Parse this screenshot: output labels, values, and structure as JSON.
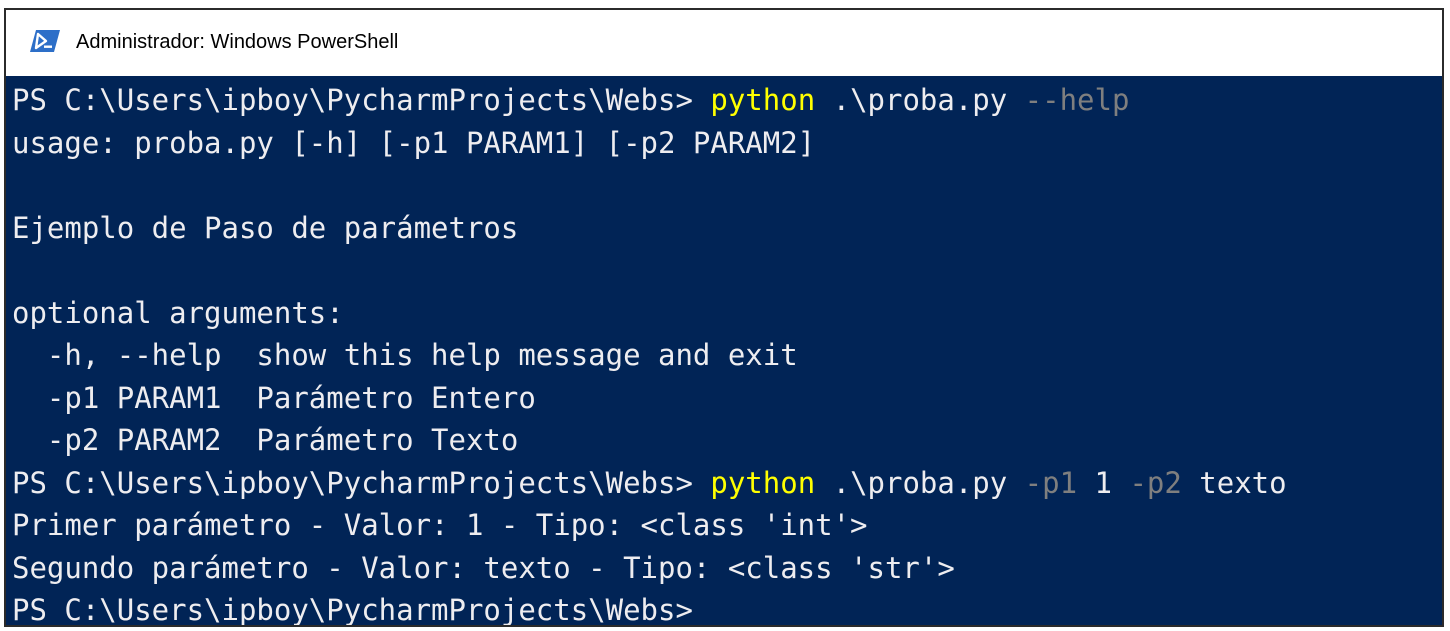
{
  "window": {
    "title": "Administrador: Windows PowerShell",
    "icon": "powershell-icon"
  },
  "colors": {
    "console_background": "#012456",
    "text": "#eeedf0",
    "command": "#ffff00",
    "parameter": "#7f7f7f",
    "titlebar": "#ffffff"
  },
  "console": {
    "lines": [
      {
        "segments": [
          {
            "text": "PS C:\\Users\\ipboy\\PycharmProjects\\Webs> ",
            "style": "text"
          },
          {
            "text": "python",
            "style": "cmd"
          },
          {
            "text": " .\\proba.py ",
            "style": "text"
          },
          {
            "text": "--help",
            "style": "param"
          }
        ]
      },
      {
        "segments": [
          {
            "text": "usage: proba.py [-h] [-p1 PARAM1] [-p2 PARAM2]",
            "style": "text"
          }
        ]
      },
      {
        "segments": [
          {
            "text": "",
            "style": "text"
          }
        ]
      },
      {
        "segments": [
          {
            "text": "Ejemplo de Paso de parámetros",
            "style": "text"
          }
        ]
      },
      {
        "segments": [
          {
            "text": "",
            "style": "text"
          }
        ]
      },
      {
        "segments": [
          {
            "text": "optional arguments:",
            "style": "text"
          }
        ]
      },
      {
        "segments": [
          {
            "text": "  -h, --help  show this help message and exit",
            "style": "text"
          }
        ]
      },
      {
        "segments": [
          {
            "text": "  -p1 PARAM1  Parámetro Entero",
            "style": "text"
          }
        ]
      },
      {
        "segments": [
          {
            "text": "  -p2 PARAM2  Parámetro Texto",
            "style": "text"
          }
        ]
      },
      {
        "segments": [
          {
            "text": "PS C:\\Users\\ipboy\\PycharmProjects\\Webs> ",
            "style": "text"
          },
          {
            "text": "python",
            "style": "cmd"
          },
          {
            "text": " .\\proba.py ",
            "style": "text"
          },
          {
            "text": "-p1",
            "style": "param"
          },
          {
            "text": " 1 ",
            "style": "text"
          },
          {
            "text": "-p2",
            "style": "param"
          },
          {
            "text": " texto",
            "style": "text"
          }
        ]
      },
      {
        "segments": [
          {
            "text": "Primer parámetro - Valor: 1 - Tipo: <class 'int'>",
            "style": "text"
          }
        ]
      },
      {
        "segments": [
          {
            "text": "Segundo parámetro - Valor: texto - Tipo: <class 'str'>",
            "style": "text"
          }
        ]
      },
      {
        "segments": [
          {
            "text": "PS C:\\Users\\ipboy\\PycharmProjects\\Webs>",
            "style": "text"
          }
        ]
      }
    ]
  }
}
